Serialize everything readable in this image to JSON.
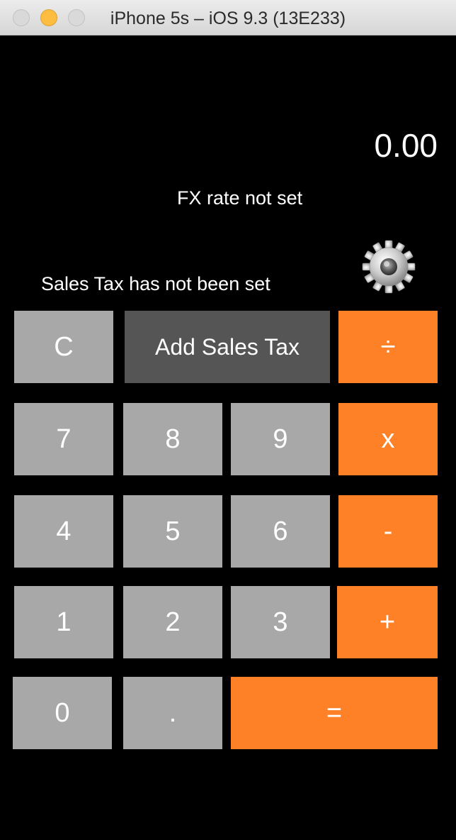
{
  "window": {
    "title": "iPhone 5s – iOS 9.3 (13E233)"
  },
  "calculator": {
    "display_value": "0.00",
    "fx_status": "FX rate not set",
    "sales_tax_status": "Sales Tax has not been set",
    "settings_icon": "gear-icon"
  },
  "keys": {
    "clear": "C",
    "add_sales_tax": "Add Sales Tax",
    "divide": "÷",
    "seven": "7",
    "eight": "8",
    "nine": "9",
    "multiply": "x",
    "four": "4",
    "five": "5",
    "six": "6",
    "subtract": "-",
    "one": "1",
    "two": "2",
    "three": "3",
    "add": "+",
    "zero": "0",
    "decimal": ".",
    "equals": "="
  },
  "colors": {
    "number_key": "#a8a8a8",
    "tax_key": "#555555",
    "operator_key": "#fe8128",
    "background": "#000000"
  }
}
